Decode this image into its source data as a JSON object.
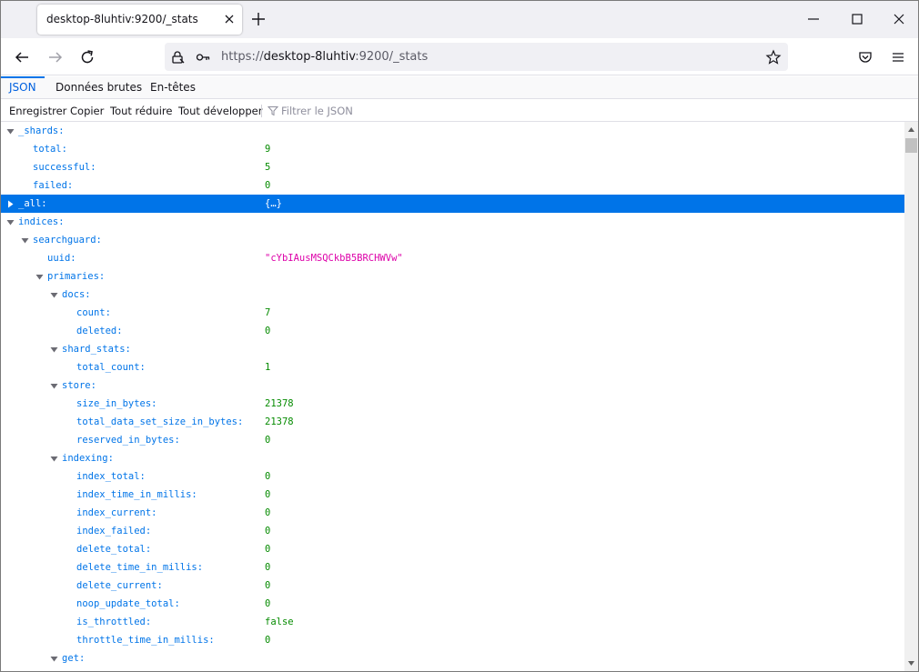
{
  "browser": {
    "tab_title": "desktop-8luhtiv:9200/_stats",
    "url_prefix": "https://",
    "url_host": "desktop-8luhtiv",
    "url_rest": ":9200/_stats"
  },
  "viewer_tabs": [
    {
      "label": "JSON",
      "active": true
    },
    {
      "label": "Données brutes",
      "active": false
    },
    {
      "label": "En-têtes",
      "active": false
    }
  ],
  "toolbar": {
    "save": "Enregistrer",
    "copy": "Copier",
    "collapse_all": "Tout réduire",
    "expand_all": "Tout développer",
    "filter_placeholder": "Filtrer le JSON"
  },
  "tree": [
    {
      "level": 0,
      "key": "_shards:",
      "value": "",
      "type": "",
      "twisty": "open"
    },
    {
      "level": 1,
      "key": "total:",
      "value": "9",
      "type": "num",
      "twisty": ""
    },
    {
      "level": 1,
      "key": "successful:",
      "value": "5",
      "type": "num",
      "twisty": ""
    },
    {
      "level": 1,
      "key": "failed:",
      "value": "0",
      "type": "num",
      "twisty": ""
    },
    {
      "level": 0,
      "key": "_all:",
      "value": "{…}",
      "type": "obj",
      "twisty": "closed",
      "selected": true
    },
    {
      "level": 0,
      "key": "indices:",
      "value": "",
      "type": "",
      "twisty": "open"
    },
    {
      "level": 1,
      "key": "searchguard:",
      "value": "",
      "type": "",
      "twisty": "open"
    },
    {
      "level": 2,
      "key": "uuid:",
      "value": "\"cYbIAusMSQCkbB5BRCHWVw\"",
      "type": "str",
      "twisty": ""
    },
    {
      "level": 2,
      "key": "primaries:",
      "value": "",
      "type": "",
      "twisty": "open"
    },
    {
      "level": 3,
      "key": "docs:",
      "value": "",
      "type": "",
      "twisty": "open"
    },
    {
      "level": 4,
      "key": "count:",
      "value": "7",
      "type": "num",
      "twisty": ""
    },
    {
      "level": 4,
      "key": "deleted:",
      "value": "0",
      "type": "num",
      "twisty": ""
    },
    {
      "level": 3,
      "key": "shard_stats:",
      "value": "",
      "type": "",
      "twisty": "open"
    },
    {
      "level": 4,
      "key": "total_count:",
      "value": "1",
      "type": "num",
      "twisty": ""
    },
    {
      "level": 3,
      "key": "store:",
      "value": "",
      "type": "",
      "twisty": "open"
    },
    {
      "level": 4,
      "key": "size_in_bytes:",
      "value": "21378",
      "type": "num",
      "twisty": ""
    },
    {
      "level": 4,
      "key": "total_data_set_size_in_bytes:",
      "value": "21378",
      "type": "num",
      "twisty": ""
    },
    {
      "level": 4,
      "key": "reserved_in_bytes:",
      "value": "0",
      "type": "num",
      "twisty": ""
    },
    {
      "level": 3,
      "key": "indexing:",
      "value": "",
      "type": "",
      "twisty": "open"
    },
    {
      "level": 4,
      "key": "index_total:",
      "value": "0",
      "type": "num",
      "twisty": ""
    },
    {
      "level": 4,
      "key": "index_time_in_millis:",
      "value": "0",
      "type": "num",
      "twisty": ""
    },
    {
      "level": 4,
      "key": "index_current:",
      "value": "0",
      "type": "num",
      "twisty": ""
    },
    {
      "level": 4,
      "key": "index_failed:",
      "value": "0",
      "type": "num",
      "twisty": ""
    },
    {
      "level": 4,
      "key": "delete_total:",
      "value": "0",
      "type": "num",
      "twisty": ""
    },
    {
      "level": 4,
      "key": "delete_time_in_millis:",
      "value": "0",
      "type": "num",
      "twisty": ""
    },
    {
      "level": 4,
      "key": "delete_current:",
      "value": "0",
      "type": "num",
      "twisty": ""
    },
    {
      "level": 4,
      "key": "noop_update_total:",
      "value": "0",
      "type": "num",
      "twisty": ""
    },
    {
      "level": 4,
      "key": "is_throttled:",
      "value": "false",
      "type": "bool",
      "twisty": ""
    },
    {
      "level": 4,
      "key": "throttle_time_in_millis:",
      "value": "0",
      "type": "num",
      "twisty": ""
    },
    {
      "level": 3,
      "key": "get:",
      "value": "",
      "type": "",
      "twisty": "open"
    }
  ],
  "icons": {
    "tab_close": "close-icon",
    "new_tab": "plus-icon",
    "back": "arrow-left-icon",
    "forward": "arrow-right-icon",
    "reload": "reload-icon",
    "site_info": "lock-icon",
    "permissions": "key-icon",
    "bookmark": "star-icon",
    "pocket": "pocket-icon",
    "menu": "hamburger-menu-icon",
    "filter": "funnel-icon"
  },
  "colors": {
    "accent": "#0074e8",
    "number": "#058b00",
    "string": "#dd00a9",
    "selected_bg": "#0074e8"
  }
}
